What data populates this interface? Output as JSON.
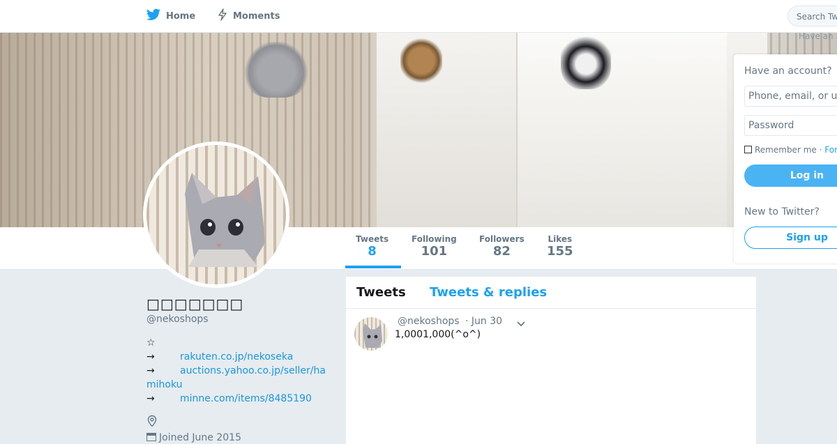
{
  "nav": {
    "home_label": "Home",
    "moments_label": "Moments",
    "search_placeholder": "Search Tw",
    "have_account_hint": "Have an a"
  },
  "profile": {
    "name": "□□□□□□□",
    "handle": "@nekoshops",
    "bio_star": "☆",
    "links": [
      {
        "arrow": "→",
        "text": "rakuten.co.jp/nekoseka"
      },
      {
        "arrow": "→",
        "text": "auctions.yahoo.co.jp/seller/hamihoku"
      },
      {
        "arrow": "→",
        "text": "minne.com/items/8485190"
      }
    ],
    "joined": "Joined June 2015"
  },
  "stats": [
    {
      "label": "Tweets",
      "value": "8"
    },
    {
      "label": "Following",
      "value": "101"
    },
    {
      "label": "Followers",
      "value": "82"
    },
    {
      "label": "Likes",
      "value": "155"
    }
  ],
  "timeline": {
    "tabs": [
      "Tweets",
      "Tweets & replies"
    ],
    "tweets": [
      {
        "handle": "@nekoshops",
        "date": "· Jun 30",
        "text": "1,0001,000(^o^)"
      }
    ]
  },
  "login": {
    "question": "Have an account?",
    "username_placeholder": "Phone, email, or u",
    "password_placeholder": "Password",
    "remember_label": "Remember me",
    "separator": "·",
    "forgot_label": "Forg",
    "login_button": "Log in",
    "new_question": "New to Twitter?",
    "signup_button": "Sign up"
  },
  "colors": {
    "accent": "#1da1f2",
    "background": "#e6ecf0"
  }
}
